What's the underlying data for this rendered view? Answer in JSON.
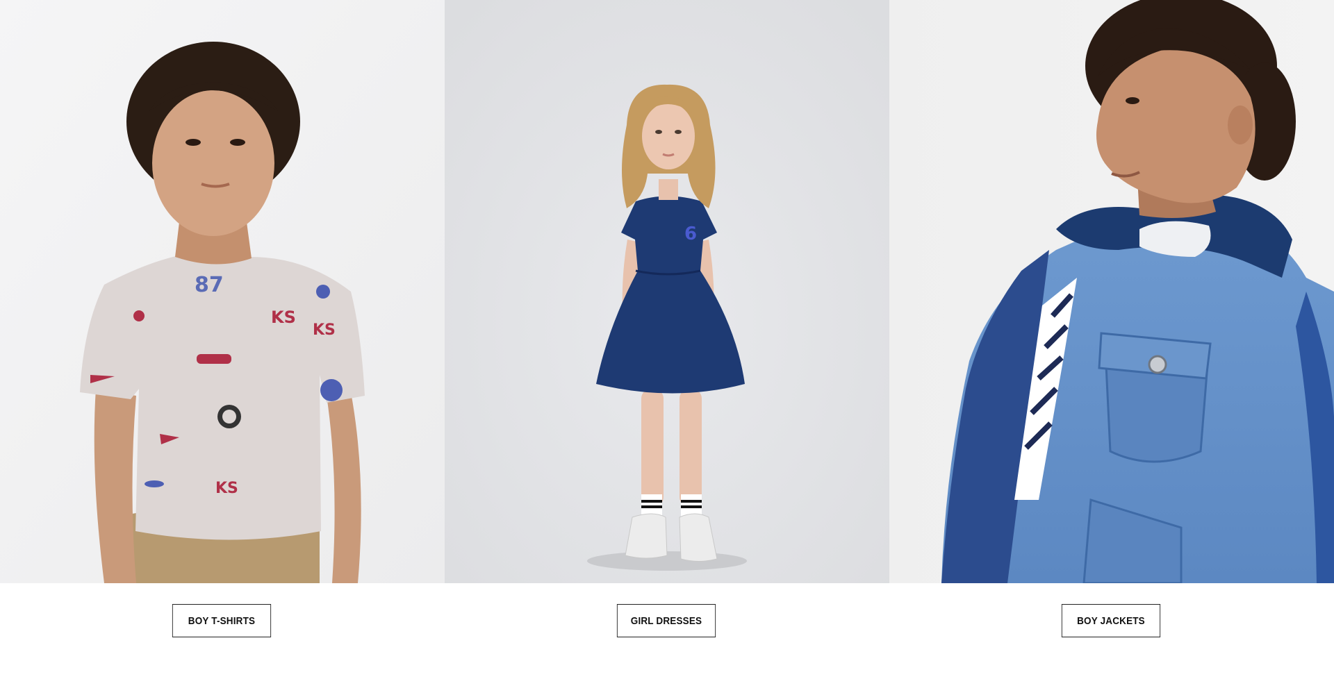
{
  "categories": [
    {
      "label": "BOY T-SHIRTS",
      "image": "boy-in-printed-tshirt-photo"
    },
    {
      "label": "GIRL DRESSES",
      "image": "girl-in-denim-dress-photo"
    },
    {
      "label": "BOY JACKETS",
      "image": "boy-in-denim-jacket-photo"
    }
  ],
  "colors": {
    "tile1_bg": "#f2f2f3",
    "tile2_bg": "#e2e3e6",
    "tile3_bg": "#f1f1f1",
    "button_border": "#222222",
    "button_text": "#111111"
  }
}
